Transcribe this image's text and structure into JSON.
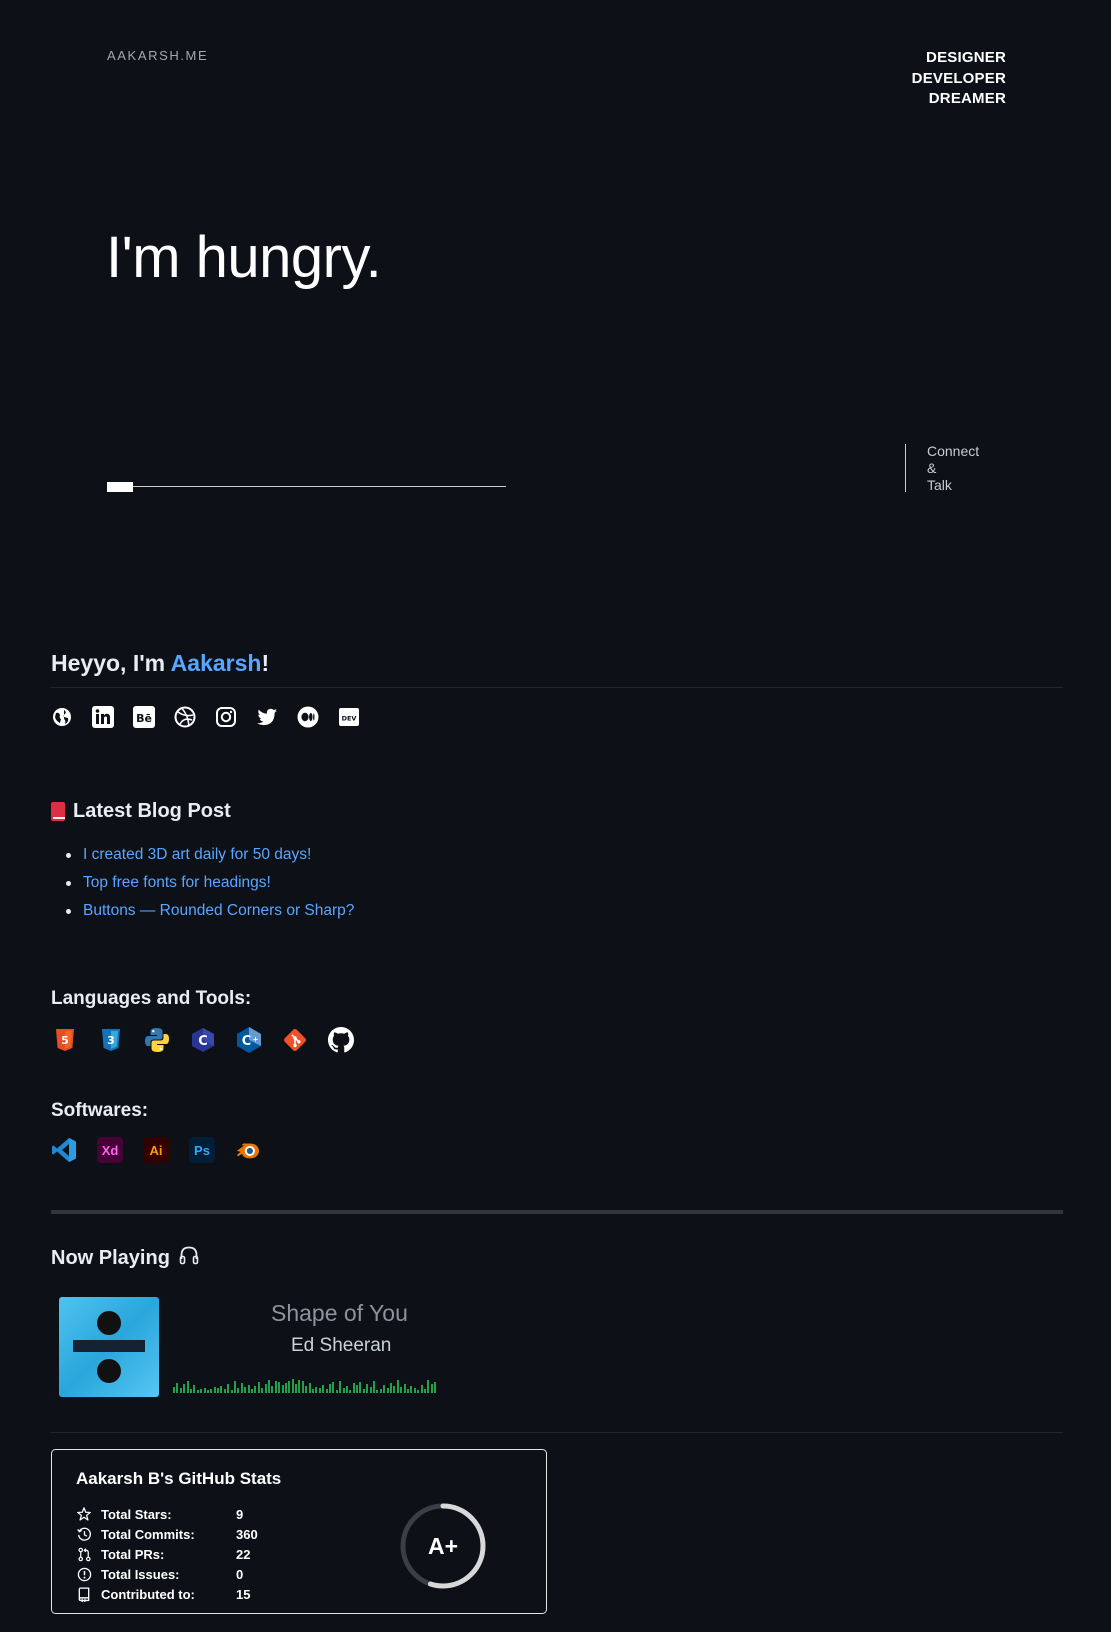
{
  "hero": {
    "brand": "AAKARSH.ME",
    "tagline": [
      "DESIGNER",
      "DEVELOPER",
      "DREAMER"
    ],
    "headline": "I'm hungry.",
    "connect": [
      "Connect",
      "&",
      "Talk"
    ]
  },
  "intro": {
    "prefix": "Heyyo, I'm ",
    "name": "Aakarsh",
    "suffix": "!"
  },
  "socials": [
    "globe-icon",
    "linkedin-icon",
    "behance-icon",
    "dribbble-icon",
    "instagram-icon",
    "twitter-icon",
    "medium-icon",
    "dev-icon"
  ],
  "blog": {
    "heading": "Latest Blog Post",
    "posts": [
      "I created 3D art daily for 50 days!",
      "Top free fonts for headings!",
      "Buttons — Rounded Corners or Sharp?"
    ]
  },
  "languages": {
    "heading": "Languages and Tools:",
    "icons": [
      "html5-icon",
      "css3-icon",
      "python-icon",
      "c-icon",
      "cplusplus-icon",
      "git-icon",
      "github-icon"
    ]
  },
  "softwares": {
    "heading": "Softwares:",
    "items": [
      {
        "icon": "vscode-icon",
        "text": ""
      },
      {
        "icon": "xd-icon",
        "text": "Xd"
      },
      {
        "icon": "illustrator-icon",
        "text": "Ai"
      },
      {
        "icon": "photoshop-icon",
        "text": "Ps"
      },
      {
        "icon": "blender-icon",
        "text": ""
      }
    ]
  },
  "now_playing": {
    "heading": "Now Playing",
    "title": "Shape of You",
    "artist": "Ed Sheeran",
    "album_text": "÷"
  },
  "github_stats": {
    "title": "Aakarsh B's GitHub Stats",
    "rows": [
      {
        "icon": "star-icon",
        "label": "Total Stars:",
        "value": "9"
      },
      {
        "icon": "history-icon",
        "label": "Total Commits:",
        "value": "360"
      },
      {
        "icon": "pull-request-icon",
        "label": "Total PRs:",
        "value": "22"
      },
      {
        "icon": "issue-icon",
        "label": "Total Issues:",
        "value": "0"
      },
      {
        "icon": "repo-icon",
        "label": "Contributed to:",
        "value": "15"
      }
    ],
    "rank": "A+",
    "rank_progress": 0.55
  },
  "colors": {
    "background": "#0d1117",
    "link": "#58a6ff",
    "visualizer": "#24a148"
  }
}
